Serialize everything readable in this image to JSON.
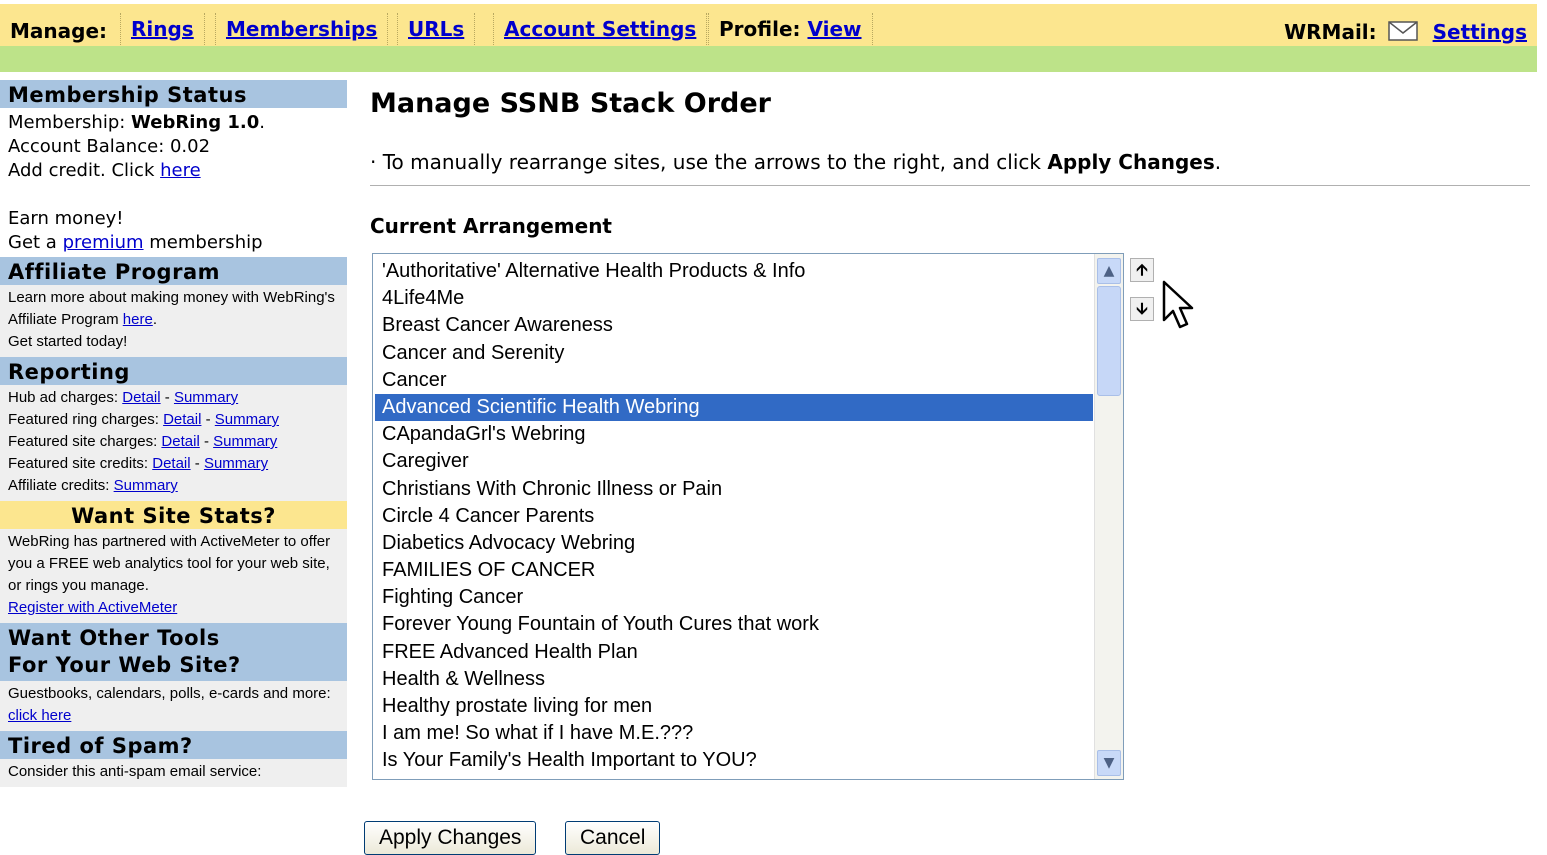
{
  "topnav": {
    "manage_label": "Manage:",
    "tabs": [
      {
        "label": "Rings"
      },
      {
        "label": "Memberships"
      },
      {
        "label": "URLs"
      },
      {
        "label": "Account Settings"
      }
    ],
    "profile_label": "Profile:",
    "profile_link": "View",
    "wrmail_label": "WRMail:",
    "mail_icon": "envelope-icon",
    "settings_link": "Settings"
  },
  "sidebar": {
    "membership_status": {
      "heading": "Membership Status",
      "membership_prefix": "Membership: ",
      "membership_value": "WebRing 1.0",
      "balance": "Account Balance: 0.02",
      "add_credit_prefix": "Add credit. Click ",
      "add_credit_link": "here",
      "earn": "Earn money!",
      "premium_prefix": "Get a ",
      "premium_link": "premium",
      "premium_suffix": " membership"
    },
    "affiliate": {
      "heading": "Affiliate Program",
      "text_prefix": "Learn more about making money with WebRing's Affiliate Program ",
      "link": "here",
      "text_suffix": "Get started today!"
    },
    "reporting": {
      "heading": "Reporting",
      "rows": [
        {
          "label": "Hub ad charges: ",
          "links": [
            "Detail",
            "Summary"
          ]
        },
        {
          "label": "Featured ring charges: ",
          "links": [
            "Detail",
            "Summary"
          ]
        },
        {
          "label": "Featured site charges: ",
          "links": [
            "Detail",
            "Summary"
          ]
        },
        {
          "label": "Featured site credits: ",
          "links": [
            "Detail",
            "Summary"
          ]
        },
        {
          "label": "Affiliate credits: ",
          "links": [
            "Summary"
          ]
        }
      ]
    },
    "site_stats": {
      "heading": "Want Site Stats?",
      "text": "WebRing has partnered with ActiveMeter to offer you a FREE web analytics tool for your web site, or rings you manage.",
      "link": "Register with ActiveMeter"
    },
    "other_tools": {
      "heading_line1": "Want Other Tools",
      "heading_line2": "For Your Web Site?",
      "text": "Guestbooks, calendars, polls, e-cards and more: ",
      "link": "click here"
    },
    "spam": {
      "heading": "Tired of Spam?",
      "text": "Consider this anti-spam email service:"
    }
  },
  "main": {
    "title": "Manage SSNB Stack Order",
    "instruction_prefix": "· To manually rearrange sites, use the arrows to the right, and click ",
    "instruction_bold": "Apply Changes",
    "instruction_suffix": ".",
    "arrangement_label": "Current Arrangement",
    "sites": [
      "'Authoritative' Alternative Health Products & Info",
      "4Life4Me",
      "Breast Cancer Awareness",
      "Cancer and Serenity",
      "Cancer",
      "Advanced Scientific Health Webring",
      "CApandaGrl's Webring",
      "Caregiver",
      "Christians With Chronic Illness or Pain",
      "Circle 4 Cancer Parents",
      "Diabetics Advocacy Webring",
      "FAMILIES OF CANCER",
      "Fighting Cancer",
      "Forever Young Fountain of Youth Cures that work",
      "FREE Advanced Health Plan",
      "Health & Wellness",
      "Healthy prostate living for men",
      "I am me! So what if I have M.E.???",
      "Is Your Family's Health Important to YOU?"
    ],
    "selected_index": 5,
    "move_up_icon": "arrow-up-icon",
    "move_down_icon": "arrow-down-icon",
    "apply_button": "Apply Changes",
    "cancel_button": "Cancel"
  }
}
